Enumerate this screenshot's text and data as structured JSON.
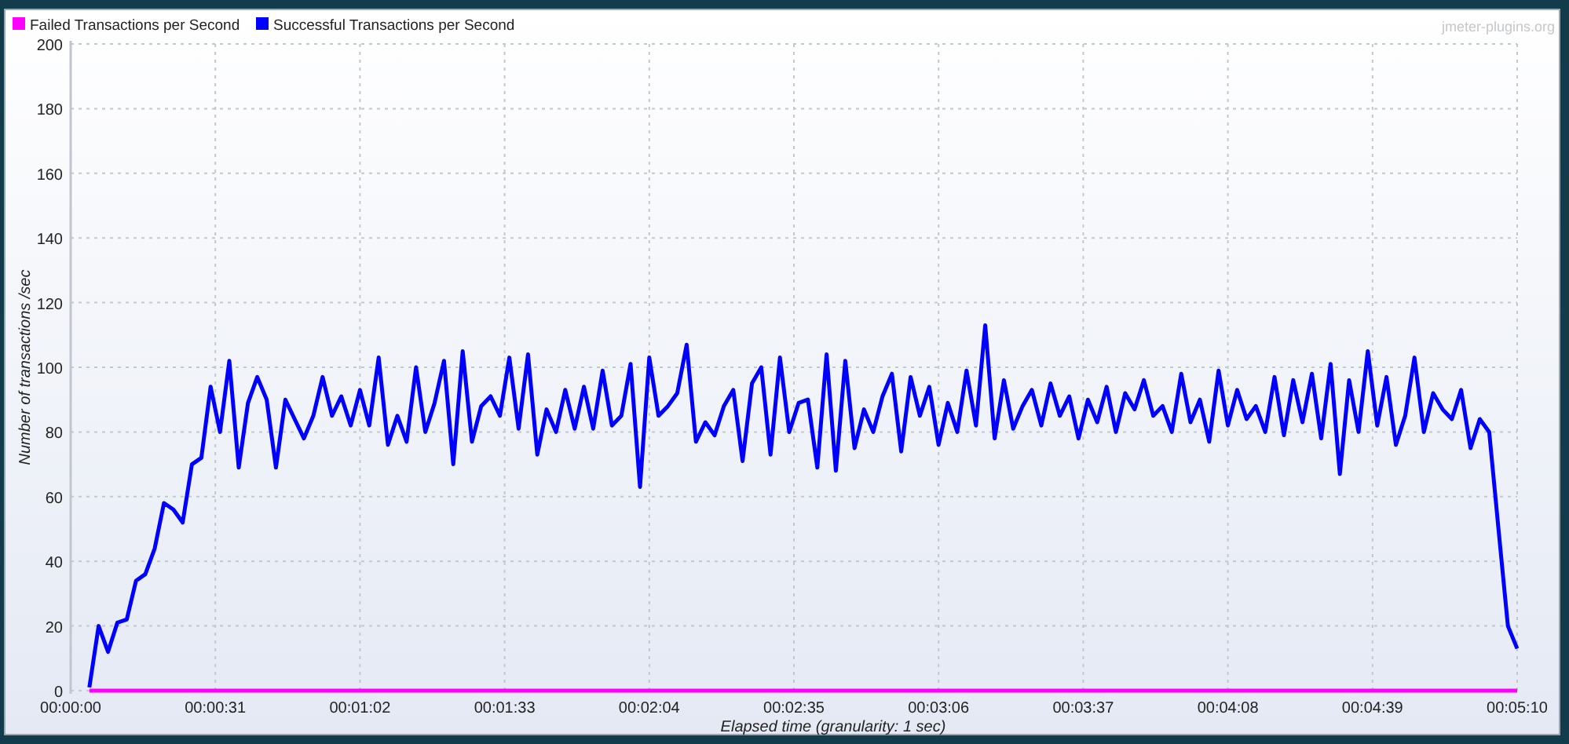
{
  "brand_label": "jmeter-plugins.org",
  "chart_data": {
    "type": "line",
    "xlabel": "Elapsed time (granularity: 1 sec)",
    "ylabel": "Number of transactions /sec",
    "grid": true,
    "legend": true,
    "xlim": [
      0,
      310
    ],
    "ylim": [
      0,
      200
    ],
    "xticks": [
      {
        "value": 0,
        "label": "00:00:00"
      },
      {
        "value": 31,
        "label": "00:00:31"
      },
      {
        "value": 62,
        "label": "00:01:02"
      },
      {
        "value": 93,
        "label": "00:01:33"
      },
      {
        "value": 124,
        "label": "00:02:04"
      },
      {
        "value": 155,
        "label": "00:02:35"
      },
      {
        "value": 186,
        "label": "00:03:06"
      },
      {
        "value": 217,
        "label": "00:03:37"
      },
      {
        "value": 248,
        "label": "00:04:08"
      },
      {
        "value": 279,
        "label": "00:04:39"
      },
      {
        "value": 310,
        "label": "00:05:10"
      }
    ],
    "yticks": [
      0,
      20,
      40,
      60,
      80,
      100,
      120,
      140,
      160,
      180,
      200
    ],
    "x": [
      4,
      6,
      8,
      10,
      12,
      14,
      16,
      18,
      20,
      22,
      24,
      26,
      28,
      30,
      32,
      34,
      36,
      38,
      40,
      42,
      44,
      46,
      48,
      50,
      52,
      54,
      56,
      58,
      60,
      62,
      64,
      66,
      68,
      70,
      72,
      74,
      76,
      78,
      80,
      82,
      84,
      86,
      88,
      90,
      92,
      94,
      96,
      98,
      100,
      102,
      104,
      106,
      108,
      110,
      112,
      114,
      116,
      118,
      120,
      122,
      124,
      126,
      128,
      130,
      132,
      134,
      136,
      138,
      140,
      142,
      144,
      146,
      148,
      150,
      152,
      154,
      156,
      158,
      160,
      162,
      164,
      166,
      168,
      170,
      172,
      174,
      176,
      178,
      180,
      182,
      184,
      186,
      188,
      190,
      192,
      194,
      196,
      198,
      200,
      202,
      204,
      206,
      208,
      210,
      212,
      214,
      216,
      218,
      220,
      222,
      224,
      226,
      228,
      230,
      232,
      234,
      236,
      238,
      240,
      242,
      244,
      246,
      248,
      250,
      252,
      254,
      256,
      258,
      260,
      262,
      264,
      266,
      268,
      270,
      272,
      274,
      276,
      278,
      280,
      282,
      284,
      286,
      288,
      290,
      292,
      294,
      296,
      298,
      300,
      302,
      304,
      306,
      308,
      310
    ],
    "series": [
      {
        "name": "Failed Transactions per Second",
        "color": "#ff00ff",
        "values": [
          0,
          0,
          0,
          0,
          0,
          0,
          0,
          0,
          0,
          0,
          0,
          0,
          0,
          0,
          0,
          0,
          0,
          0,
          0,
          0,
          0,
          0,
          0,
          0,
          0,
          0,
          0,
          0,
          0,
          0,
          0,
          0,
          0,
          0,
          0,
          0,
          0,
          0,
          0,
          0,
          0,
          0,
          0,
          0,
          0,
          0,
          0,
          0,
          0,
          0,
          0,
          0,
          0,
          0,
          0,
          0,
          0,
          0,
          0,
          0,
          0,
          0,
          0,
          0,
          0,
          0,
          0,
          0,
          0,
          0,
          0,
          0,
          0,
          0,
          0,
          0,
          0,
          0,
          0,
          0,
          0,
          0,
          0,
          0,
          0,
          0,
          0,
          0,
          0,
          0,
          0,
          0,
          0,
          0,
          0,
          0,
          0,
          0,
          0,
          0,
          0,
          0,
          0,
          0,
          0,
          0,
          0,
          0,
          0,
          0,
          0,
          0,
          0,
          0,
          0,
          0,
          0,
          0,
          0,
          0,
          0,
          0,
          0,
          0,
          0,
          0,
          0,
          0,
          0,
          0,
          0,
          0,
          0,
          0,
          0,
          0,
          0,
          0,
          0,
          0,
          0,
          0,
          0,
          0,
          0,
          0,
          0,
          0,
          0,
          0,
          0,
          0,
          0,
          0
        ]
      },
      {
        "name": "Successful Transactions per Second",
        "color": "#0000ff",
        "values": [
          1,
          20,
          12,
          21,
          22,
          34,
          36,
          44,
          58,
          56,
          52,
          70,
          72,
          94,
          80,
          102,
          69,
          89,
          97,
          90,
          69,
          90,
          84,
          78,
          85,
          97,
          85,
          91,
          82,
          93,
          82,
          103,
          76,
          85,
          77,
          100,
          80,
          89,
          102,
          70,
          105,
          77,
          88,
          91,
          85,
          103,
          81,
          104,
          73,
          87,
          80,
          93,
          81,
          94,
          81,
          99,
          82,
          85,
          101,
          63,
          103,
          85,
          88,
          92,
          107,
          77,
          83,
          79,
          88,
          93,
          71,
          95,
          100,
          73,
          103,
          80,
          89,
          90,
          69,
          104,
          68,
          102,
          75,
          87,
          80,
          91,
          98,
          74,
          97,
          85,
          94,
          76,
          89,
          80,
          99,
          82,
          113,
          78,
          96,
          81,
          88,
          93,
          82,
          95,
          85,
          91,
          78,
          90,
          83,
          94,
          80,
          92,
          87,
          96,
          85,
          88,
          80,
          98,
          83,
          90,
          77,
          99,
          82,
          93,
          84,
          88,
          80,
          97,
          79,
          96,
          83,
          98,
          78,
          101,
          67,
          96,
          80,
          105,
          82,
          97,
          76,
          85,
          103,
          80,
          92,
          87,
          84,
          93,
          75,
          84,
          80,
          50,
          20,
          13
        ]
      }
    ]
  }
}
